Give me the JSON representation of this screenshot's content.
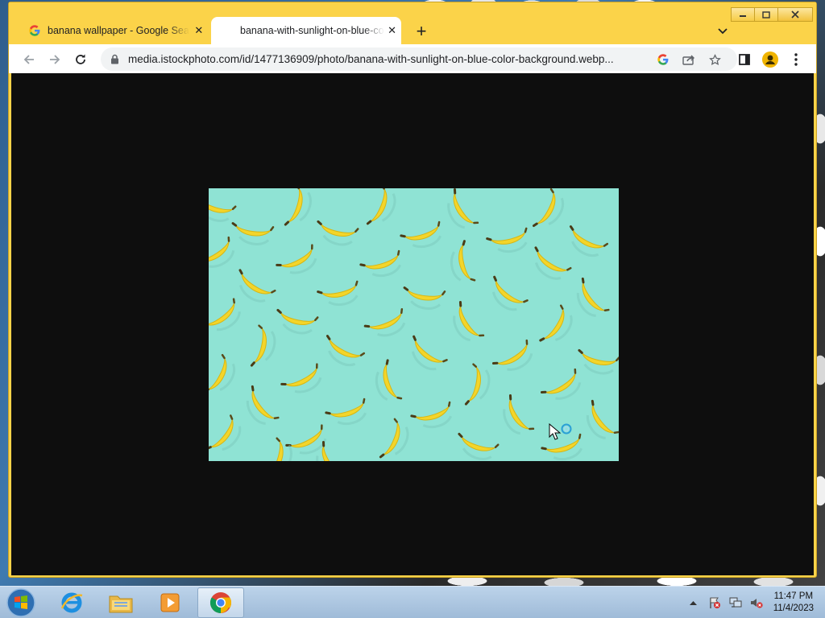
{
  "browser": {
    "tabs": [
      {
        "title": "banana wallpaper - Google Search",
        "icon": "google-icon",
        "active": false
      },
      {
        "title": "banana-with-sunlight-on-blue-color-background.webp",
        "icon": "none",
        "active": true
      }
    ],
    "new_tab_label": "+",
    "window_controls": [
      "minimize",
      "maximize",
      "close"
    ],
    "address_bar": {
      "url": "media.istockphoto.com/id/1477136909/photo/banana-with-sunlight-on-blue-color-background.webp..."
    },
    "content": {
      "image_background": "#8fe3d4",
      "page_background": "#0e0e0e"
    },
    "theme": {
      "frame_color": "#fbd349"
    }
  },
  "taskbar": {
    "apps": [
      {
        "name": "internet-explorer",
        "icon": "ie-icon"
      },
      {
        "name": "windows-explorer",
        "icon": "folder-icon"
      },
      {
        "name": "media-player",
        "icon": "media-player-icon"
      },
      {
        "name": "google-chrome",
        "icon": "chrome-icon",
        "active": true
      }
    ],
    "clock": {
      "time": "11:47 PM",
      "date": "11/4/2023"
    }
  }
}
